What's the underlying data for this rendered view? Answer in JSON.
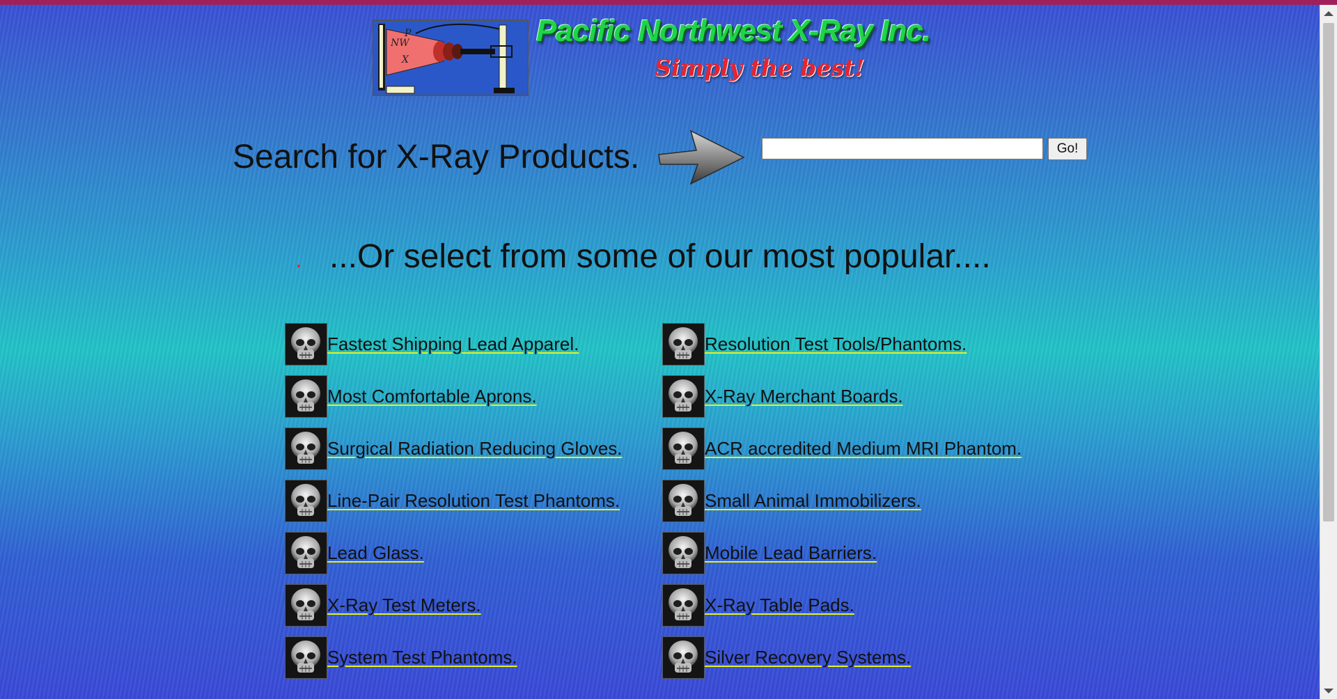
{
  "header": {
    "logo_text": "PNWX",
    "title": "Pacific Northwest X-Ray Inc.",
    "tagline": "Simply the best!"
  },
  "search": {
    "heading": "Search for X-Ray Products.",
    "input_value": "",
    "button_label": "Go!"
  },
  "popular": {
    "bullet": ".",
    "heading": "...Or select from some of our most popular...."
  },
  "products": {
    "left": [
      "Fastest Shipping Lead Apparel.",
      "Most Comfortable Aprons.",
      "Surgical Radiation Reducing Gloves.",
      "Line-Pair Resolution Test Phantoms.",
      "Lead Glass.",
      "X-Ray Test Meters.",
      "System Test Phantoms."
    ],
    "right": [
      "Resolution Test Tools/Phantoms.",
      "X-Ray Merchant Boards.",
      "ACR accredited Medium MRI Phantom.",
      "Small Animal Immobilizers.",
      "Mobile Lead Barriers.",
      "X-Ray Table Pads.",
      "Silver Recovery Systems."
    ]
  },
  "colors": {
    "top_bar": "#a0205c",
    "link_underline": "#e6f21a",
    "title_green": "#1fd34a",
    "tagline_red": "#e8242d"
  },
  "icons": {
    "search_arrow": "arrow-right-icon",
    "list_bullet": "skull-xray-icon"
  }
}
